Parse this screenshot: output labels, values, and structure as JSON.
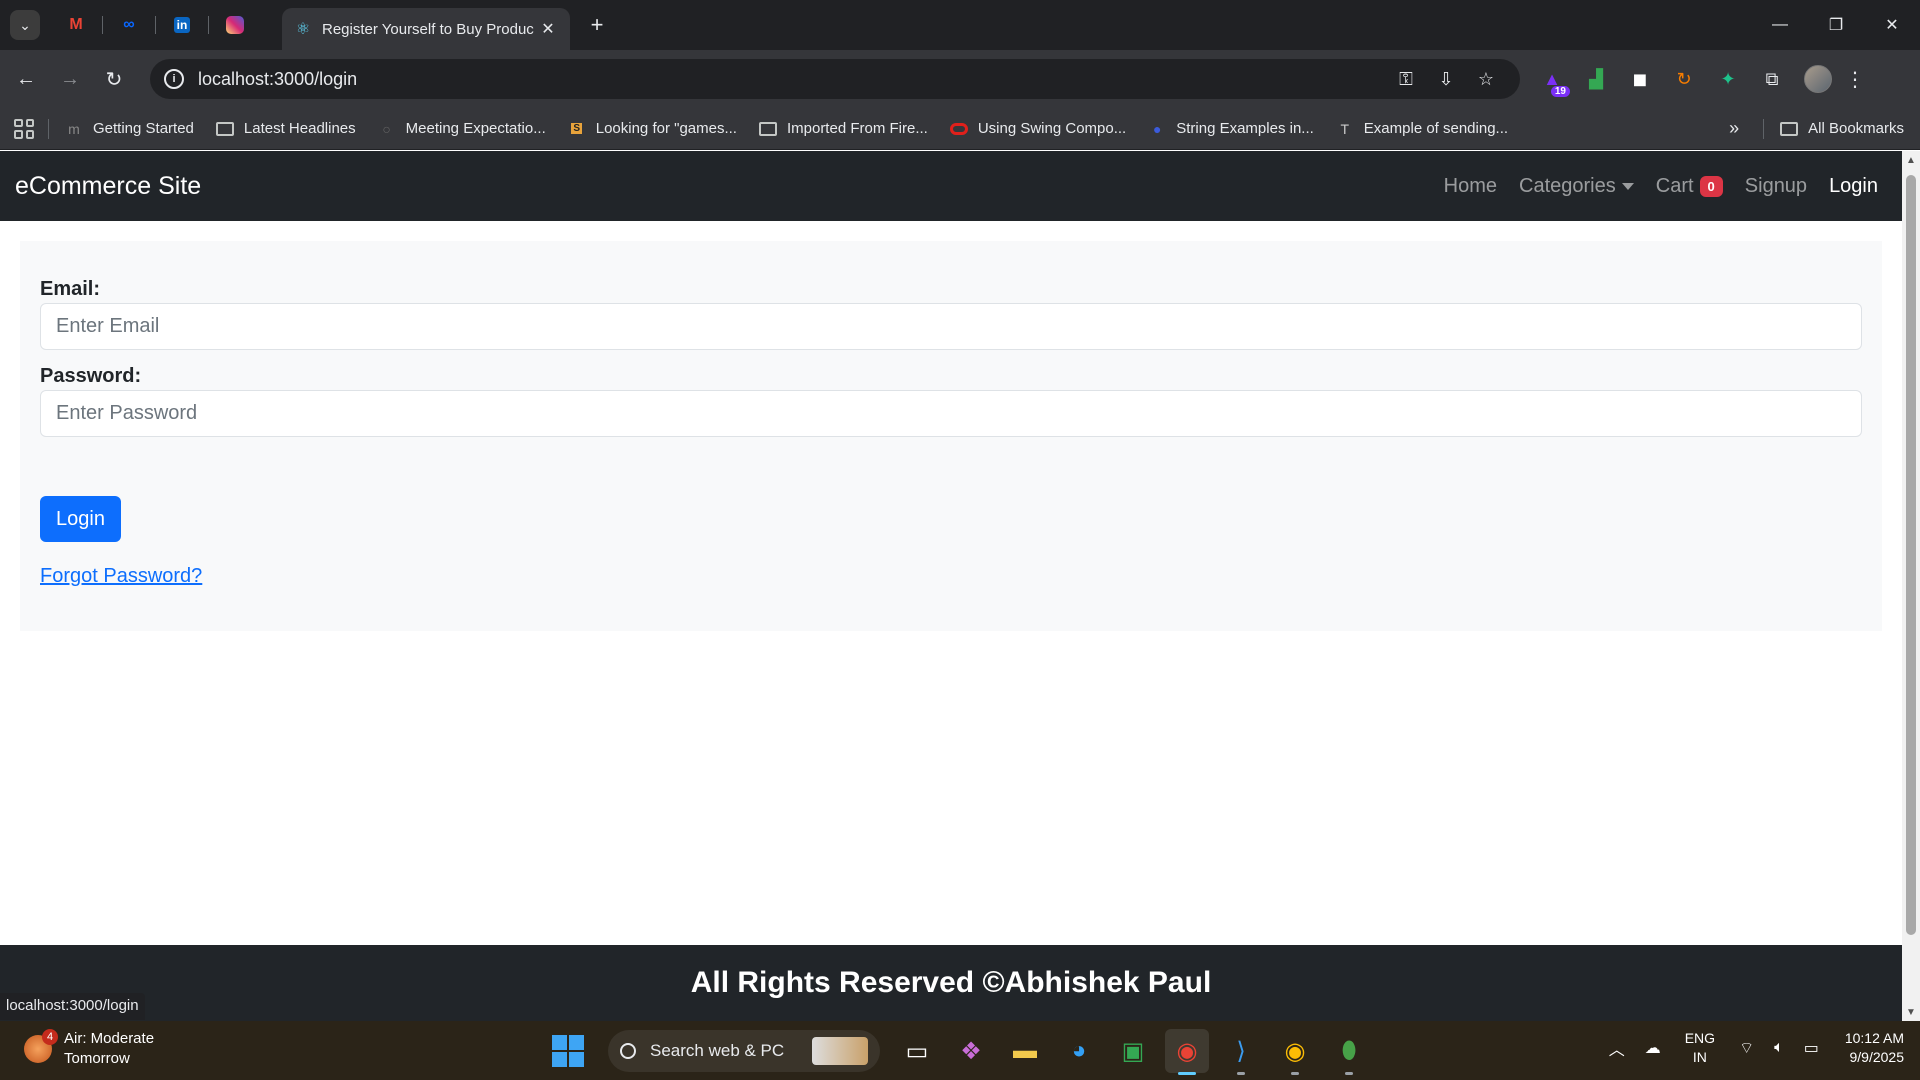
{
  "browser": {
    "active_tab_title": "Register Yourself to Buy Produc",
    "url": "localhost:3000/login",
    "status_url": "localhost:3000/login",
    "extension_badge": "19",
    "bookmarks": [
      "Getting Started",
      "Latest Headlines",
      "Meeting Expectatio...",
      "Looking for \"games...",
      "Imported From Fire...",
      "Using Swing Compo...",
      "String Examples in...",
      "Example of sending..."
    ],
    "all_bookmarks": "All Bookmarks"
  },
  "site": {
    "brand": "eCommerce Site",
    "nav": {
      "home": "Home",
      "categories": "Categories",
      "cart": "Cart",
      "cart_count": "0",
      "signup": "Signup",
      "login": "Login"
    }
  },
  "login_form": {
    "email_label": "Email:",
    "email_placeholder": "Enter Email",
    "password_label": "Password:",
    "password_placeholder": "Enter Password",
    "submit_label": "Login",
    "forgot_link": "Forgot Password?"
  },
  "footer": {
    "text": "All Rights Reserved ©Abhishek Paul"
  },
  "taskbar": {
    "weather_title": "Air: Moderate",
    "weather_subtitle": "Tomorrow",
    "weather_badge": "4",
    "search_placeholder": "Search web & PC",
    "lang_line1": "ENG",
    "lang_line2": "IN",
    "time": "10:12 AM",
    "date": "9/9/2025"
  },
  "colors": {
    "navbar_bg": "#212529",
    "primary": "#0d6efd",
    "badge_danger": "#dc3545",
    "card_bg": "#f8f9fa"
  }
}
